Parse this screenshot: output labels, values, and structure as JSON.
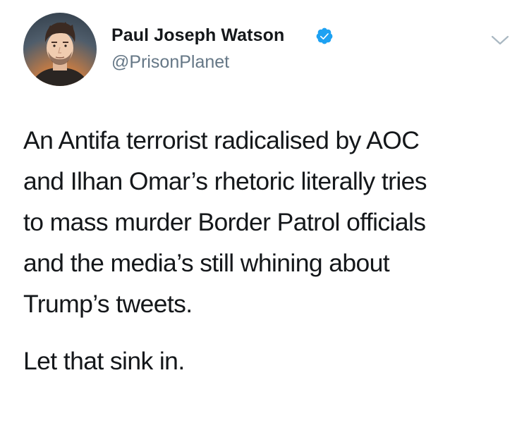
{
  "author": {
    "display_name": "Paul Joseph Watson",
    "handle": "@PrisonPlanet",
    "verified": true,
    "verified_color": "#1da1f2"
  },
  "tweet": {
    "lines": [
      "An Antifa terrorist radicalised by AOC",
      "and Ilhan Omar’s rhetoric literally tries",
      "to mass murder Border Patrol officials",
      "and the media’s still whining about",
      "Trump’s tweets."
    ],
    "closing_line": "Let that sink in."
  },
  "icons": {
    "menu": "chevron-down-icon",
    "verified": "verified-badge-icon",
    "avatar": "profile-photo"
  },
  "colors": {
    "text": "#14171a",
    "secondary_text": "#657786",
    "chevron": "#aab8c2"
  }
}
